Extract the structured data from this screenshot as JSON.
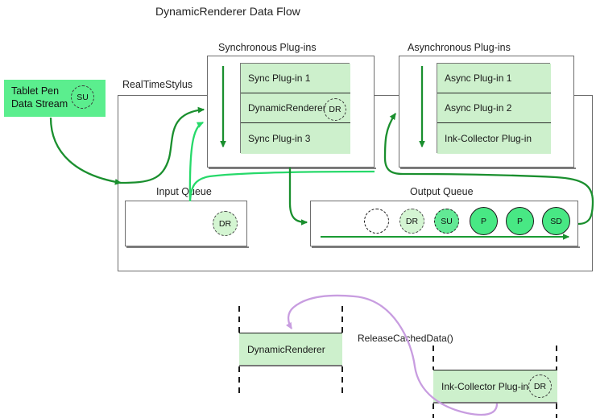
{
  "diagram": {
    "title": "DynamicRenderer Data Flow",
    "accent_green_dark": "#1a8f2e",
    "accent_green_bright": "#27d96a",
    "accent_purple": "#c89de0",
    "fill_light_green": "#cdf0cc",
    "fill_bright_green": "#5bee8e"
  },
  "stream": {
    "line1": "Tablet Pen",
    "line2": "Data Stream",
    "badge": "SU"
  },
  "realtimestylus": {
    "label": "RealTimeStylus"
  },
  "sync_group": {
    "caption": "Synchronous Plug-ins",
    "plugins": [
      {
        "label": "Sync Plug-in 1",
        "badge": ""
      },
      {
        "label": "DynamicRenderer",
        "badge": "DR"
      },
      {
        "label": "Sync Plug-in 3",
        "badge": ""
      }
    ]
  },
  "async_group": {
    "caption": "Asynchronous Plug-ins",
    "plugins": [
      {
        "label": "Async Plug-in 1",
        "badge": ""
      },
      {
        "label": "Async Plug-in 2",
        "badge": ""
      },
      {
        "label": "Ink-Collector Plug-in",
        "badge": ""
      }
    ]
  },
  "input_queue": {
    "caption": "Input Queue",
    "items": [
      {
        "label": "DR",
        "style": "dr-light"
      }
    ]
  },
  "output_queue": {
    "caption": "Output Queue",
    "items": [
      {
        "label": "",
        "style": "dash-black"
      },
      {
        "label": "DR",
        "style": "dr-light"
      },
      {
        "label": "SU",
        "style": "su-mid"
      },
      {
        "label": "P",
        "style": "solid"
      },
      {
        "label": "P",
        "style": "solid"
      },
      {
        "label": "SD",
        "style": "solid"
      }
    ]
  },
  "sequence": {
    "call_label": "ReleaseCachedData()",
    "left_actor": "DynamicRenderer",
    "right_actor": "Ink-Collector Plug-in",
    "right_actor_badge": "DR"
  }
}
